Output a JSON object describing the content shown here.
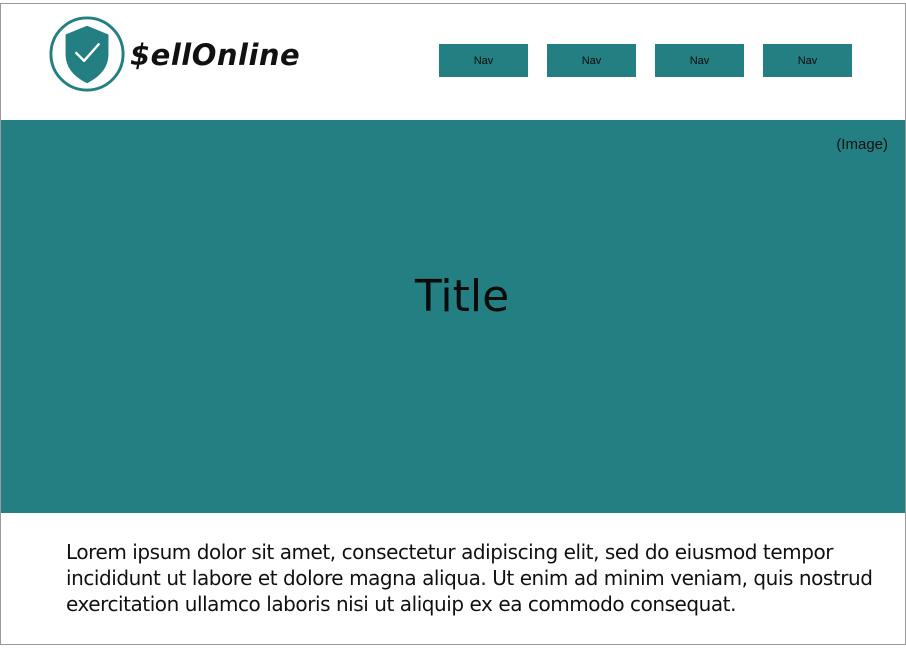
{
  "header": {
    "brand": "$ellOnline",
    "nav": [
      {
        "label": "Nav"
      },
      {
        "label": "Nav"
      },
      {
        "label": "Nav"
      },
      {
        "label": "Nav"
      }
    ]
  },
  "hero": {
    "image_label": "(Image)",
    "title": "Title"
  },
  "content": {
    "paragraph": "Lorem ipsum dolor sit amet, consectetur adipiscing elit, sed do eiusmod tempor incididunt ut labore et dolore magna aliqua. Ut enim ad minim veniam, quis nostrud exercitation ullamco laboris nisi ut aliquip ex ea commodo consequat."
  },
  "colors": {
    "accent": "#237f82",
    "background": "#ffffff",
    "text": "#111111"
  },
  "icons": {
    "logo": "shield-check-icon"
  }
}
